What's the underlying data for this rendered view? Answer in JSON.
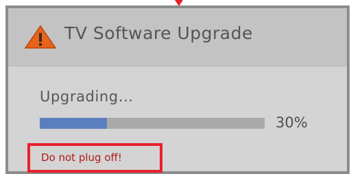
{
  "dialog": {
    "title": "TV Software Upgrade",
    "icon": "warning-triangle-icon"
  },
  "progress": {
    "status_label": "Upgrading...",
    "fraction": 0.3,
    "percent_text": "30%"
  },
  "warning": {
    "message": "Do not plug off!"
  },
  "colors": {
    "frame_border": "#8c8c8c",
    "title_bg": "#c3c3c3",
    "body_bg": "#d4d4d4",
    "progress_track": "#a9a9a9",
    "progress_fill": "#5c7fc0",
    "warning_outline": "#e8202a",
    "warning_text": "#b01a1a",
    "icon_orange": "#e8641a"
  }
}
